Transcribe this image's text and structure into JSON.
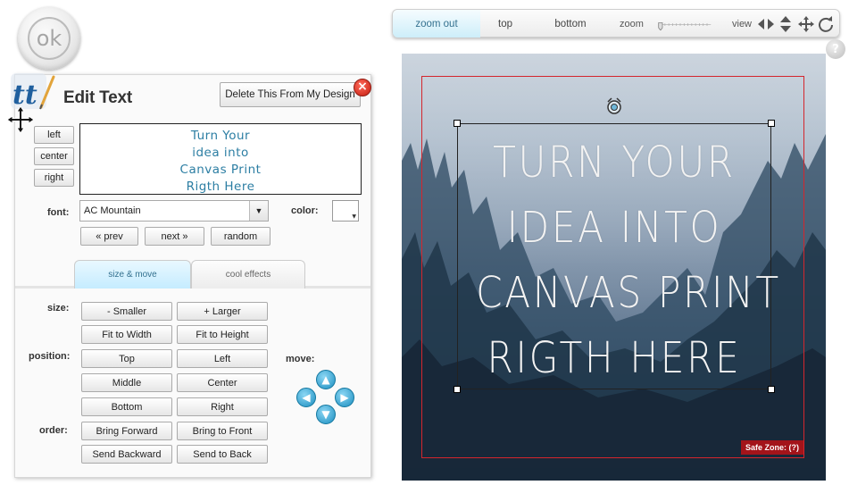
{
  "ok_button": {
    "label": "ok"
  },
  "editor": {
    "title": "Edit Text",
    "delete_label": "Delete This From My Design",
    "close_glyph": "x",
    "align_buttons": [
      "left",
      "center",
      "right"
    ],
    "text_lines": [
      "Turn Your",
      "idea into",
      "Canvas Print",
      "Rigth Here"
    ],
    "font_label": "font:",
    "font_value": "AC Mountain",
    "color_label": "color:",
    "prev_label": "« prev",
    "next_label": "next »",
    "random_label": "random",
    "tabs": [
      {
        "label": "size & move",
        "active": true
      },
      {
        "label": "cool effects",
        "active": false
      }
    ],
    "size_label": "size:",
    "position_label": "position:",
    "order_label": "order:",
    "move_label": "move:",
    "buttons": {
      "smaller": "- Smaller",
      "larger": "+ Larger",
      "fit_width": "Fit to Width",
      "fit_height": "Fit to Height",
      "top": "Top",
      "left": "Left",
      "middle": "Middle",
      "center": "Center",
      "bottom": "Bottom",
      "right": "Right",
      "bring_forward": "Bring Forward",
      "bring_front": "Bring to Front",
      "send_backward": "Send Backward",
      "send_back": "Send to Back"
    }
  },
  "toolbar": {
    "zoom_out": "zoom out",
    "top": "top",
    "bottom": "bottom",
    "zoom": "zoom",
    "view": "view"
  },
  "canvas": {
    "lines": [
      "Turn Your",
      "idea into",
      "Canvas Print",
      "Rigth Here"
    ],
    "safe_zone_label": "Safe Zone: (?)"
  },
  "colors": {
    "accent_blue": "#2c7ea3",
    "safe_zone_red": "#d4262d",
    "tab_active": "#c5ecff"
  },
  "icons": [
    "tt-logo-icon",
    "move-cross-icon",
    "close-icon",
    "arrow-up-icon",
    "arrow-left-icon",
    "arrow-right-icon",
    "arrow-down-icon",
    "pan-left-right-icon",
    "pan-up-down-icon",
    "pan-all-icon",
    "rotate-icon",
    "help-icon"
  ]
}
